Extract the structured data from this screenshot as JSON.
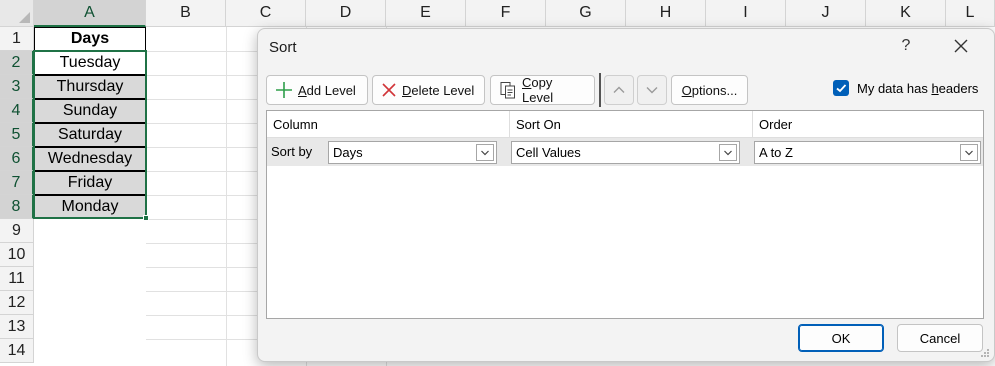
{
  "sheet": {
    "columns": [
      "A",
      "B",
      "C",
      "D",
      "E",
      "F",
      "G",
      "H",
      "I",
      "J",
      "K",
      "L"
    ],
    "rows": [
      "1",
      "2",
      "3",
      "4",
      "5",
      "6",
      "7",
      "8",
      "9",
      "10",
      "11",
      "12",
      "13",
      "14"
    ],
    "header_cell": "Days",
    "values": [
      "Tuesday",
      "Thursday",
      "Sunday",
      "Saturday",
      "Wednesday",
      "Friday",
      "Monday"
    ]
  },
  "dialog": {
    "title": "Sort",
    "help": "?",
    "toolbar": {
      "add_level": {
        "accel": "A",
        "rest": "dd Level"
      },
      "delete_level": {
        "accel": "D",
        "rest": "elete Level"
      },
      "copy_level": {
        "accel": "C",
        "rest": "opy Level"
      },
      "options": {
        "accel": "O",
        "rest": "ptions..."
      }
    },
    "headers_checkbox": {
      "pre": "My data has ",
      "accel": "h",
      "post": "eaders",
      "checked": true
    },
    "columns": {
      "column": "Column",
      "sort_on": "Sort On",
      "order": "Order"
    },
    "level": {
      "label": "Sort by",
      "column_value": "Days",
      "sort_on_value": "Cell Values",
      "order_value": "A to Z"
    },
    "ok": "OK",
    "cancel": "Cancel"
  },
  "colors": {
    "excel_green": "#1f7246",
    "accent_blue": "#005fb8",
    "add_icon_green": "#2e9e4a",
    "delete_icon_red": "#d13438"
  }
}
